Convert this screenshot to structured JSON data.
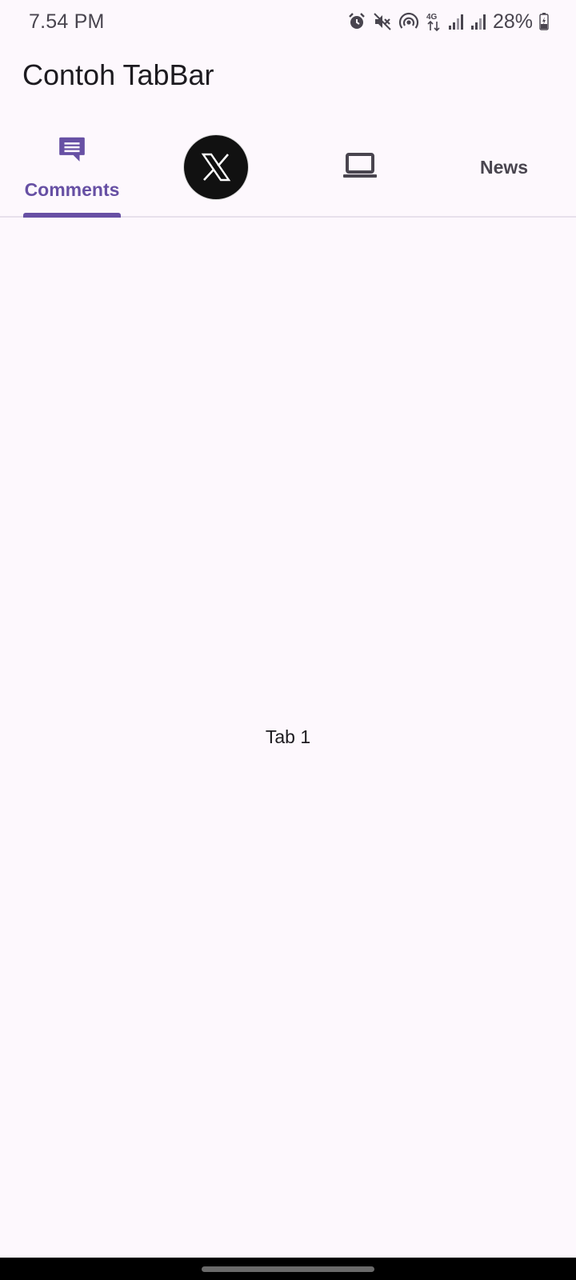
{
  "status_bar": {
    "time": "7.54 PM",
    "icons": [
      "alarm-icon",
      "mute-icon",
      "hotspot-icon",
      "4g-icon",
      "signal-icon",
      "signal-icon",
      "battery-icon"
    ],
    "battery": "28%"
  },
  "app_bar": {
    "title": "Contoh TabBar"
  },
  "tabs": [
    {
      "label": "Comments",
      "icon": "comment-icon",
      "selected": true
    },
    {
      "label": "",
      "icon": "x-logo",
      "selected": false
    },
    {
      "label": "",
      "icon": "laptop-icon",
      "selected": false
    },
    {
      "label": "News",
      "icon": "",
      "selected": false
    }
  ],
  "content": {
    "text": "Tab 1"
  },
  "colors": {
    "accent": "#6750a4",
    "background": "#fdf8fd",
    "divider": "#e7e0ec"
  }
}
